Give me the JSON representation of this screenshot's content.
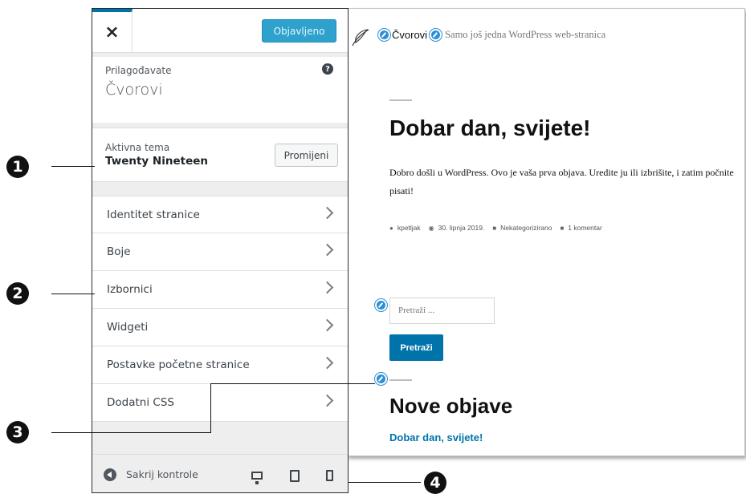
{
  "sidebar": {
    "close_label": "×",
    "publish_label": "Objavljeno",
    "customizing_label": "Prilagođavate",
    "site_name": "Čvorovi",
    "help_label": "?",
    "theme": {
      "label": "Aktivna tema",
      "name": "Twenty Nineteen",
      "change_label": "Promijeni"
    },
    "menu": [
      {
        "label": "Identitet stranice"
      },
      {
        "label": "Boje"
      },
      {
        "label": "Izbornici"
      },
      {
        "label": "Widgeti"
      },
      {
        "label": "Postavke početne stranice"
      },
      {
        "label": "Dodatni CSS"
      }
    ],
    "footer": {
      "collapse_label": "Sakrij kontrole"
    }
  },
  "preview": {
    "site_title": "Čvorovi",
    "site_description": "Samo još jedna WordPress web-stranica",
    "post": {
      "title": "Dobar dan, svijete!",
      "body": "Dobro došli u WordPress. Ovo je vaša prva objava. Uredite ju ili izbrišite, i zatim počnite pisati!",
      "author": "kpetljak",
      "date": "30. lipnja 2019.",
      "category": "Nekategorizirano",
      "comments": "1 komentar"
    },
    "search": {
      "placeholder": "Pretraži ...",
      "button_label": "Pretraži"
    },
    "recent": {
      "title": "Nove objave",
      "items": [
        "Dobar dan, svijete!"
      ]
    }
  },
  "callouts": [
    "1",
    "2",
    "3",
    "4"
  ],
  "colors": {
    "accent": "#0073aa",
    "publish": "#2ea2cc",
    "edit_shortcut": "#2d8fd5"
  }
}
